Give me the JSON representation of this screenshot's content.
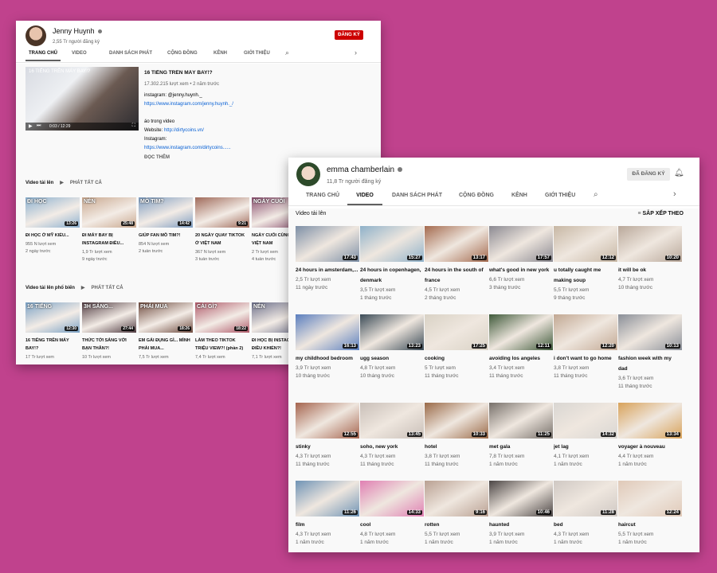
{
  "win1": {
    "channel_name": "Jenny Huynh",
    "subscribers": "2,55 Tr người đăng ký",
    "subscribe_label": "ĐĂNG KÝ",
    "tabs": [
      "TRANG CHỦ",
      "VIDEO",
      "DANH SÁCH PHÁT",
      "CỘNG ĐỒNG",
      "KÊNH",
      "GIỚI THIỆU"
    ],
    "featured": {
      "thumb_overlay": "16 TIẾNG TRÊN MÁY BAY!?",
      "time": "0:03 / 12:29",
      "title": "16 TIẾNG TRÊN MÁY BAY!?",
      "stats": "17.302.215 lượt xem • 2 năm trước",
      "desc1": "instagram: @jenny.huynh._",
      "link1": "https://www.instagram.com/jenny.huynh._/",
      "desc2": "áo trong video",
      "website_label": "Website: ",
      "link2": "http://dirtycoins.vn/",
      "instagram_label": "Instagram:",
      "link3": "https://www.instagram.com/dirtycoins......",
      "readmore": "ĐỌC THÊM"
    },
    "sections": [
      {
        "title": "Video tải lên",
        "playall": "PHÁT TẤT CẢ",
        "videos": [
          {
            "title": "ĐI HỌC Ở MỸ KIỂU...",
            "views": "955 N lượt xem",
            "age": "2 ngày trước",
            "duration": "13:26",
            "overlay": "ĐI HỌC",
            "color": "#8bb0cf"
          },
          {
            "title": "ĐI MÁY BAY BỊ INSTAGRAM ĐIỀU...",
            "views": "1,9 Tr lượt xem",
            "age": "9 ngày trước",
            "duration": "25:48",
            "overlay": "NÉN",
            "color": "#c9a88f"
          },
          {
            "title": "GIÚP FAN MỒ TIM?!",
            "views": "854 N lượt xem",
            "age": "2 tuần trước",
            "duration": "14:42",
            "overlay": "MỒ TIM?",
            "color": "#7d9cc0"
          },
          {
            "title": "20 NGÀY QUAY TIKTOK Ở VIỆT NAM",
            "views": "367 N lượt xem",
            "age": "3 tuần trước",
            "duration": "9:21",
            "overlay": "",
            "color": "#a06a5a"
          },
          {
            "title": "NGÀY CUỐI CÙNG Ở VIỆT NAM",
            "views": "2 Tr lượt xem",
            "age": "4 tuần trước",
            "duration": "",
            "overlay": "NGÀY CUỐI",
            "color": "#8a4f6e"
          }
        ]
      },
      {
        "title": "Video tải lên phổ biến",
        "playall": "PHÁT TẤT CẢ",
        "videos": [
          {
            "title": "16 TIẾNG TRÊN MÁY BAY!?",
            "views": "17 Tr lượt xem",
            "age": "",
            "duration": "12:30",
            "overlay": "16 TIẾNG",
            "color": "#7aa1c4"
          },
          {
            "title": "THỨC TỚI SÁNG VỚI BẠN THÂN?!",
            "views": "10 Tr lượt xem",
            "age": "",
            "duration": "27:44",
            "overlay": "3H SÁNG...",
            "color": "#4f3a40"
          },
          {
            "title": "EM GÁI ĐỤNG GÌ... MÌNH PHẢI MUA...",
            "views": "7,5 Tr lượt xem",
            "age": "",
            "duration": "18:26",
            "overlay": "PHẢI MUA",
            "color": "#6e4a3e"
          },
          {
            "title": "LÀM THEO TIKTOK TRIỆU VIEW?! (phần 2)",
            "views": "7,4 Tr lượt xem",
            "age": "",
            "duration": "18:22",
            "overlay": "CÁI GÌ?",
            "color": "#b05a6a"
          },
          {
            "title": "ĐI HỌC BỊ INSTAGRAM ĐIỀU KHIỂN?!",
            "views": "7,1 Tr lượt xem",
            "age": "",
            "duration": "",
            "overlay": "NÉN",
            "color": "#6c6f8a"
          }
        ]
      }
    ]
  },
  "win2": {
    "channel_name": "emma chamberlain",
    "subscribers": "11,8 Tr người đăng ký",
    "subscribed_label": "ĐÃ ĐĂNG KÝ",
    "tabs": [
      "TRANG CHỦ",
      "VIDEO",
      "DANH SÁCH PHÁT",
      "CỘNG ĐỒNG",
      "KÊNH",
      "GIỚI THIỆU"
    ],
    "section_title": "Video tải lên",
    "sort_label": "SẮP XẾP THEO",
    "videos": [
      {
        "title": "24 hours in amsterdam,...",
        "views": "2,5 Tr lượt xem",
        "age": "11 ngày trước",
        "duration": "17:43",
        "color": "#7d8fa6"
      },
      {
        "title": "24 hours in copenhagen, denmark",
        "views": "3,5 Tr lượt xem",
        "age": "1 tháng trước",
        "duration": "15:27",
        "color": "#8fb1c9"
      },
      {
        "title": "24 hours in the south of france",
        "views": "4,5 Tr lượt xem",
        "age": "2 tháng trước",
        "duration": "13:17",
        "color": "#a46a4e"
      },
      {
        "title": "what's good in new york",
        "views": "6,6 Tr lượt xem",
        "age": "3 tháng trước",
        "duration": "17:57",
        "color": "#8c8a92"
      },
      {
        "title": "u totally caught me making soup",
        "views": "5,5 Tr lượt xem",
        "age": "9 tháng trước",
        "duration": "12:12",
        "color": "#c7b7a4"
      },
      {
        "title": "it will be ok",
        "views": "4,7 Tr lượt xem",
        "age": "10 tháng trước",
        "duration": "10:20",
        "color": "#b9a89a"
      },
      {
        "title": "my childhood bedroom",
        "views": "3,9 Tr lượt xem",
        "age": "10 tháng trước",
        "duration": "16:13",
        "color": "#5b7fbf"
      },
      {
        "title": "ugg season",
        "views": "4,8 Tr lượt xem",
        "age": "10 tháng trước",
        "duration": "13:23",
        "color": "#3a4a56"
      },
      {
        "title": "cooking",
        "views": "5 Tr lượt xem",
        "age": "11 tháng trước",
        "duration": "17:25",
        "color": "#d9d2c5"
      },
      {
        "title": "avoiding los angeles",
        "views": "3,4 Tr lượt xem",
        "age": "11 tháng trước",
        "duration": "12:11",
        "color": "#3f5a3a"
      },
      {
        "title": "i don't want to go home",
        "views": "3,8 Tr lượt xem",
        "age": "11 tháng trước",
        "duration": "12:20",
        "color": "#c2a893"
      },
      {
        "title": "fashion week with my dad",
        "views": "3,6 Tr lượt xem",
        "age": "11 tháng trước",
        "duration": "10:13",
        "color": "#8a8f98"
      },
      {
        "title": "stinky",
        "views": "4,3 Tr lượt xem",
        "age": "11 tháng trước",
        "duration": "12:55",
        "color": "#a5644e"
      },
      {
        "title": "soho, new york",
        "views": "4,3 Tr lượt xem",
        "age": "11 tháng trước",
        "duration": "13:45",
        "color": "#c9bfb8"
      },
      {
        "title": "hotel",
        "views": "3,8 Tr lượt xem",
        "age": "11 tháng trước",
        "duration": "10:33",
        "color": "#9a6a48"
      },
      {
        "title": "met gala",
        "views": "7,8 Tr lượt xem",
        "age": "1 năm trước",
        "duration": "11:25",
        "color": "#77706a"
      },
      {
        "title": "jet lag",
        "views": "4,1 Tr lượt xem",
        "age": "1 năm trước",
        "duration": "14:32",
        "color": "#d9d6d2"
      },
      {
        "title": "voyager à nouveau",
        "views": "4,4 Tr lượt xem",
        "age": "1 năm trước",
        "duration": "13:34",
        "color": "#d8a25a"
      },
      {
        "title": "film",
        "views": "4,3 Tr lượt xem",
        "age": "1 năm trước",
        "duration": "11:26",
        "color": "#6f93b5"
      },
      {
        "title": "cool",
        "views": "4,8 Tr lượt xem",
        "age": "1 năm trước",
        "duration": "14:33",
        "color": "#e07fb2"
      },
      {
        "title": "rotten",
        "views": "5,5 Tr lượt xem",
        "age": "1 năm trước",
        "duration": "9:16",
        "color": "#b9a092"
      },
      {
        "title": "haunted",
        "views": "3,9 Tr lượt xem",
        "age": "1 năm trước",
        "duration": "10:46",
        "color": "#4b4544"
      },
      {
        "title": "bed",
        "views": "4,3 Tr lượt xem",
        "age": "1 năm trước",
        "duration": "11:28",
        "color": "#cfc8c3"
      },
      {
        "title": "haircut",
        "views": "5,5 Tr lượt xem",
        "age": "1 năm trước",
        "duration": "12:24",
        "color": "#e0c9b8"
      }
    ]
  }
}
